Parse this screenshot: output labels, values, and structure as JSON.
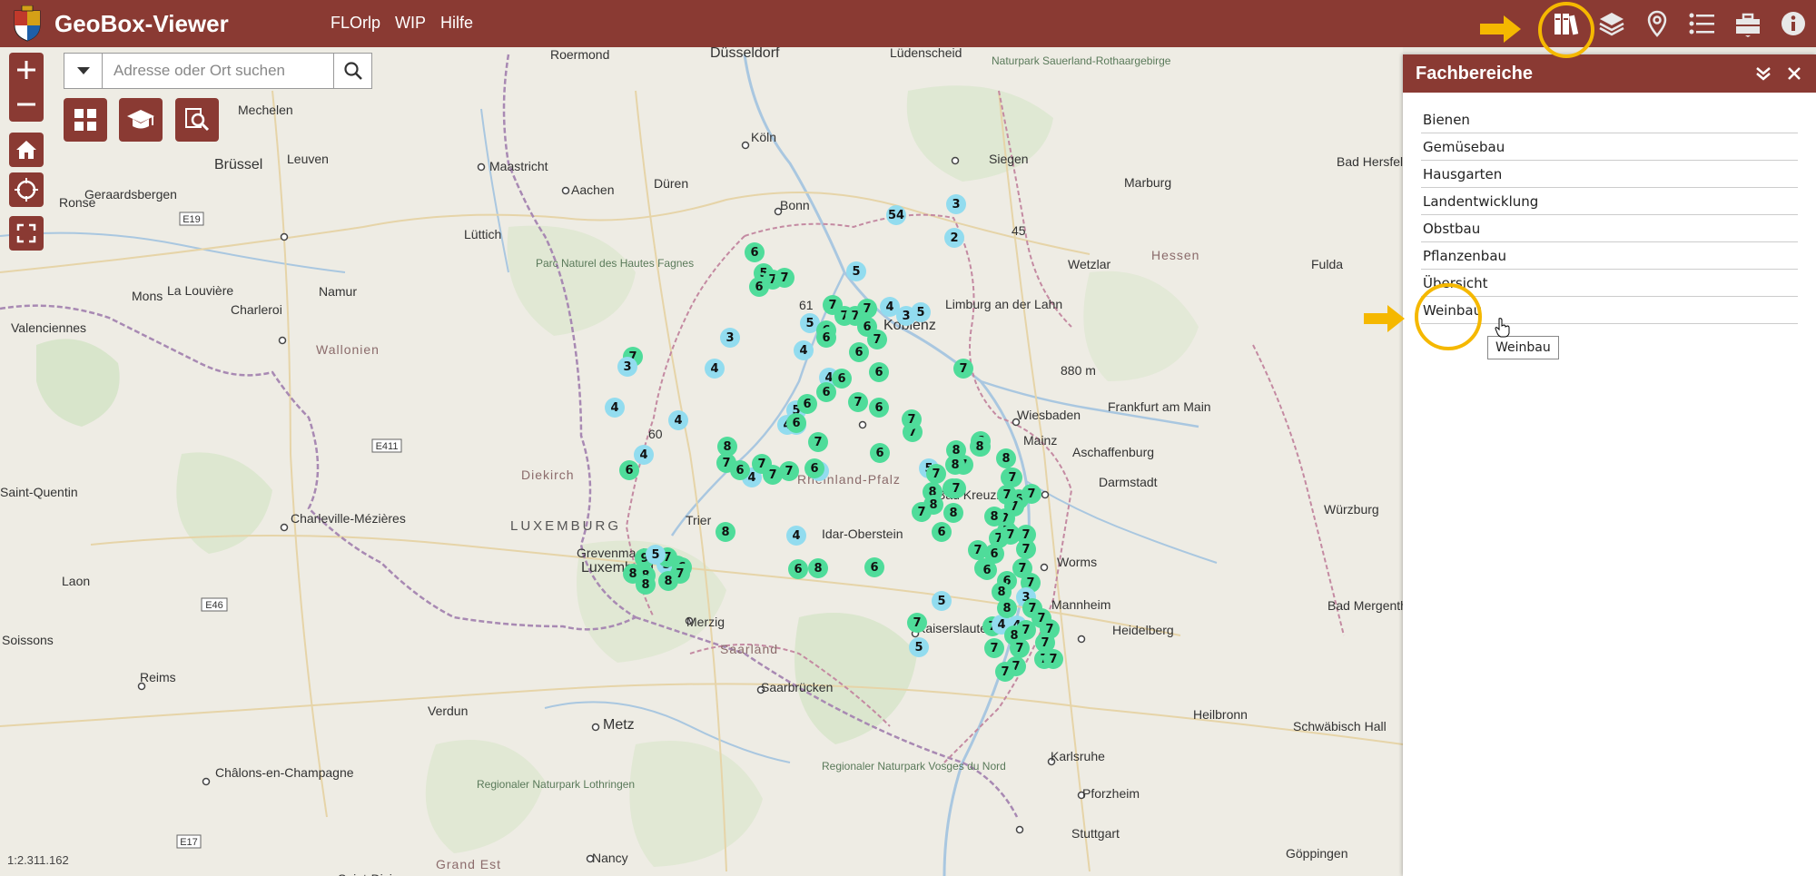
{
  "app": {
    "title": "GeoBox-Viewer",
    "nav": [
      "FLOrlp",
      "WIP",
      "Hilfe"
    ],
    "accent_color": "#8a3a33",
    "highlight_color": "#f5b800"
  },
  "toolbar": {
    "icons": [
      "books-icon",
      "layers-icon",
      "location-pin-icon",
      "list-icon",
      "toolbox-icon",
      "info-icon"
    ]
  },
  "search": {
    "placeholder": "Adresse oder Ort suchen"
  },
  "map": {
    "scale": "1:2.311.162",
    "places": [
      {
        "name": "Düsseldorf"
      },
      {
        "name": "Roermond"
      },
      {
        "name": "Lüdenscheid"
      },
      {
        "name": "Naturpark Sauerland-Rothaargebirge"
      },
      {
        "name": "Mechelen"
      },
      {
        "name": "Brüssel"
      },
      {
        "name": "Leuven"
      },
      {
        "name": "Maastricht"
      },
      {
        "name": "Aachen"
      },
      {
        "name": "Düren"
      },
      {
        "name": "Köln"
      },
      {
        "name": "Siegen"
      },
      {
        "name": "Bad Hersfeld"
      },
      {
        "name": "Ronse"
      },
      {
        "name": "Geraardsbergen"
      },
      {
        "name": "Bonn"
      },
      {
        "name": "Marburg"
      },
      {
        "name": "Lüttich"
      },
      {
        "name": "Hessen"
      },
      {
        "name": "Parc Naturel des Hautes Fagnes"
      },
      {
        "name": "Wetzlar"
      },
      {
        "name": "Fulda"
      },
      {
        "name": "La Louvière"
      },
      {
        "name": "Mons"
      },
      {
        "name": "Charleroi"
      },
      {
        "name": "Namur"
      },
      {
        "name": "Limburg an der Lahn"
      },
      {
        "name": "Valenciennes"
      },
      {
        "name": "Koblenz"
      },
      {
        "name": "Wallonien"
      },
      {
        "name": "880 m"
      },
      {
        "name": "Wiesbaden"
      },
      {
        "name": "Frankfurt am Main"
      },
      {
        "name": "Mainz"
      },
      {
        "name": "Aschaffenburg"
      },
      {
        "name": "Diekirch"
      },
      {
        "name": "Rheinland-Pfalz"
      },
      {
        "name": "Saint-Quentin"
      },
      {
        "name": "Darmstadt"
      },
      {
        "name": "Würzburg"
      },
      {
        "name": "Charleville-Mézières"
      },
      {
        "name": "LUXEMBURG"
      },
      {
        "name": "Trier"
      },
      {
        "name": "Bad Kreuznach"
      },
      {
        "name": "Idar-Oberstein"
      },
      {
        "name": "Grevenmacher"
      },
      {
        "name": "Luxemburg"
      },
      {
        "name": "Worms"
      },
      {
        "name": "Laon"
      },
      {
        "name": "Mannheim"
      },
      {
        "name": "Bad Mergentheim"
      },
      {
        "name": "Merzig"
      },
      {
        "name": "Kaiserslautern"
      },
      {
        "name": "Heidelberg"
      },
      {
        "name": "Soissons"
      },
      {
        "name": "Saarland"
      },
      {
        "name": "Reims"
      },
      {
        "name": "Saarbrücken"
      },
      {
        "name": "Verdun"
      },
      {
        "name": "Metz"
      },
      {
        "name": "Heilbronn"
      },
      {
        "name": "Schwäbisch Hall"
      },
      {
        "name": "Karlsruhe"
      },
      {
        "name": "Regionaler Naturpark Vosges du Nord"
      },
      {
        "name": "Châlons-en-Champagne"
      },
      {
        "name": "Regionaler Naturpark Lothringen"
      },
      {
        "name": "Pforzheim"
      },
      {
        "name": "Stuttgart"
      },
      {
        "name": "Nancy"
      },
      {
        "name": "Göppingen"
      },
      {
        "name": "Grand Est"
      },
      {
        "name": "Saint-Dizier"
      },
      {
        "name": "E19"
      },
      {
        "name": "E411"
      },
      {
        "name": "E46"
      },
      {
        "name": "E17"
      },
      {
        "name": "45"
      },
      {
        "name": "61"
      },
      {
        "name": "60"
      }
    ],
    "markers": [
      {
        "v": "6",
        "c": "g"
      },
      {
        "v": "5",
        "c": "g"
      },
      {
        "v": "7",
        "c": "g"
      },
      {
        "v": "7",
        "c": "g"
      },
      {
        "v": "6",
        "c": "g"
      },
      {
        "v": "54",
        "c": "b"
      },
      {
        "v": "3",
        "c": "b"
      },
      {
        "v": "2",
        "c": "b"
      },
      {
        "v": "5",
        "c": "b"
      },
      {
        "v": "7",
        "c": "g"
      },
      {
        "v": "7",
        "c": "g"
      },
      {
        "v": "7",
        "c": "g"
      },
      {
        "v": "7",
        "c": "g"
      },
      {
        "v": "4",
        "c": "b"
      },
      {
        "v": "3",
        "c": "b"
      },
      {
        "v": "5",
        "c": "b"
      },
      {
        "v": "5",
        "c": "b"
      },
      {
        "v": "6",
        "c": "g"
      },
      {
        "v": "7",
        "c": "g"
      },
      {
        "v": "6",
        "c": "g"
      },
      {
        "v": "6",
        "c": "g"
      },
      {
        "v": "7",
        "c": "g"
      },
      {
        "v": "3",
        "c": "b"
      },
      {
        "v": "3",
        "c": "b"
      },
      {
        "v": "4",
        "c": "b"
      },
      {
        "v": "4",
        "c": "b"
      },
      {
        "v": "6",
        "c": "g"
      },
      {
        "v": "6",
        "c": "g"
      },
      {
        "v": "7",
        "c": "g"
      },
      {
        "v": "4",
        "c": "b"
      },
      {
        "v": "6",
        "c": "g"
      },
      {
        "v": "6",
        "c": "g"
      },
      {
        "v": "7",
        "c": "g"
      },
      {
        "v": "4",
        "c": "b"
      },
      {
        "v": "4",
        "c": "b"
      },
      {
        "v": "5",
        "c": "b"
      },
      {
        "v": "6",
        "c": "g"
      },
      {
        "v": "6",
        "c": "g"
      },
      {
        "v": "3",
        "c": "b"
      },
      {
        "v": "7",
        "c": "g"
      },
      {
        "v": "4",
        "c": "b"
      },
      {
        "v": "5",
        "c": "b"
      },
      {
        "v": "4",
        "c": "b"
      },
      {
        "v": "6",
        "c": "g"
      },
      {
        "v": "7",
        "c": "g"
      },
      {
        "v": "7",
        "c": "g"
      },
      {
        "v": "6",
        "c": "g"
      },
      {
        "v": "6",
        "c": "g"
      },
      {
        "v": "6",
        "c": "g"
      },
      {
        "v": "4",
        "c": "b"
      },
      {
        "v": "7",
        "c": "g"
      },
      {
        "v": "6",
        "c": "g"
      },
      {
        "v": "7",
        "c": "g"
      },
      {
        "v": "7",
        "c": "g"
      },
      {
        "v": "7",
        "c": "g"
      },
      {
        "v": "8",
        "c": "g"
      },
      {
        "v": "6",
        "c": "g"
      },
      {
        "v": "8",
        "c": "g"
      },
      {
        "v": "6",
        "c": "g"
      },
      {
        "v": "7",
        "c": "g"
      },
      {
        "v": "8",
        "c": "g"
      },
      {
        "v": "5",
        "c": "b"
      },
      {
        "v": "8",
        "c": "g"
      },
      {
        "v": "7",
        "c": "g"
      },
      {
        "v": "7",
        "c": "g"
      },
      {
        "v": "8",
        "c": "g"
      },
      {
        "v": "8",
        "c": "g"
      },
      {
        "v": "7",
        "c": "g"
      },
      {
        "v": "8",
        "c": "g"
      },
      {
        "v": "7",
        "c": "g"
      },
      {
        "v": "7",
        "c": "g"
      },
      {
        "v": "8",
        "c": "g"
      },
      {
        "v": "7",
        "c": "g"
      },
      {
        "v": "7",
        "c": "g"
      },
      {
        "v": "7",
        "c": "g"
      },
      {
        "v": "6",
        "c": "g"
      },
      {
        "v": "7",
        "c": "g"
      },
      {
        "v": "8",
        "c": "g"
      },
      {
        "v": "7",
        "c": "g"
      },
      {
        "v": "7",
        "c": "g"
      },
      {
        "v": "7",
        "c": "g"
      },
      {
        "v": "6",
        "c": "g"
      },
      {
        "v": "7",
        "c": "g"
      },
      {
        "v": "7",
        "c": "g"
      },
      {
        "v": "7",
        "c": "g"
      },
      {
        "v": "7",
        "c": "g"
      },
      {
        "v": "7",
        "c": "g"
      },
      {
        "v": "6",
        "c": "g"
      },
      {
        "v": "6",
        "c": "g"
      },
      {
        "v": "7",
        "c": "g"
      },
      {
        "v": "6",
        "c": "g"
      },
      {
        "v": "7",
        "c": "g"
      },
      {
        "v": "8",
        "c": "g"
      },
      {
        "v": "3",
        "c": "b"
      },
      {
        "v": "7",
        "c": "g"
      },
      {
        "v": "4",
        "c": "b"
      },
      {
        "v": "7",
        "c": "g"
      },
      {
        "v": "4",
        "c": "b"
      },
      {
        "v": "6",
        "c": "g"
      },
      {
        "v": "8",
        "c": "g"
      },
      {
        "v": "8",
        "c": "g"
      },
      {
        "v": "6",
        "c": "g"
      },
      {
        "v": "7",
        "c": "g"
      },
      {
        "v": "7",
        "c": "g"
      },
      {
        "v": "5",
        "c": "b"
      },
      {
        "v": "6",
        "c": "g"
      },
      {
        "v": "7",
        "c": "g"
      },
      {
        "v": "8",
        "c": "g"
      },
      {
        "v": "7",
        "c": "g"
      },
      {
        "v": "8",
        "c": "g"
      },
      {
        "v": "9",
        "c": "g"
      },
      {
        "v": "5",
        "c": "b"
      },
      {
        "v": "8",
        "c": "g"
      },
      {
        "v": "8",
        "c": "g"
      },
      {
        "v": "5",
        "c": "b"
      },
      {
        "v": "4",
        "c": "b"
      },
      {
        "v": "8",
        "c": "g"
      },
      {
        "v": "7",
        "c": "g"
      },
      {
        "v": "8",
        "c": "g"
      },
      {
        "v": "7",
        "c": "g"
      },
      {
        "v": "7",
        "c": "g"
      },
      {
        "v": "7",
        "c": "g"
      },
      {
        "v": "5",
        "c": "b"
      },
      {
        "v": "7",
        "c": "g"
      },
      {
        "v": "7",
        "c": "g"
      },
      {
        "v": "7",
        "c": "g"
      },
      {
        "v": "7",
        "c": "g"
      },
      {
        "v": "7",
        "c": "g"
      },
      {
        "v": "7",
        "c": "g"
      }
    ]
  },
  "panel": {
    "title": "Fachbereiche",
    "items": [
      "Bienen",
      "Gemüsebau",
      "Hausgarten",
      "Landentwicklung",
      "Obstbau",
      "Pflanzenbau",
      "Übersicht",
      "Weinbau"
    ],
    "tooltip": "Weinbau"
  }
}
